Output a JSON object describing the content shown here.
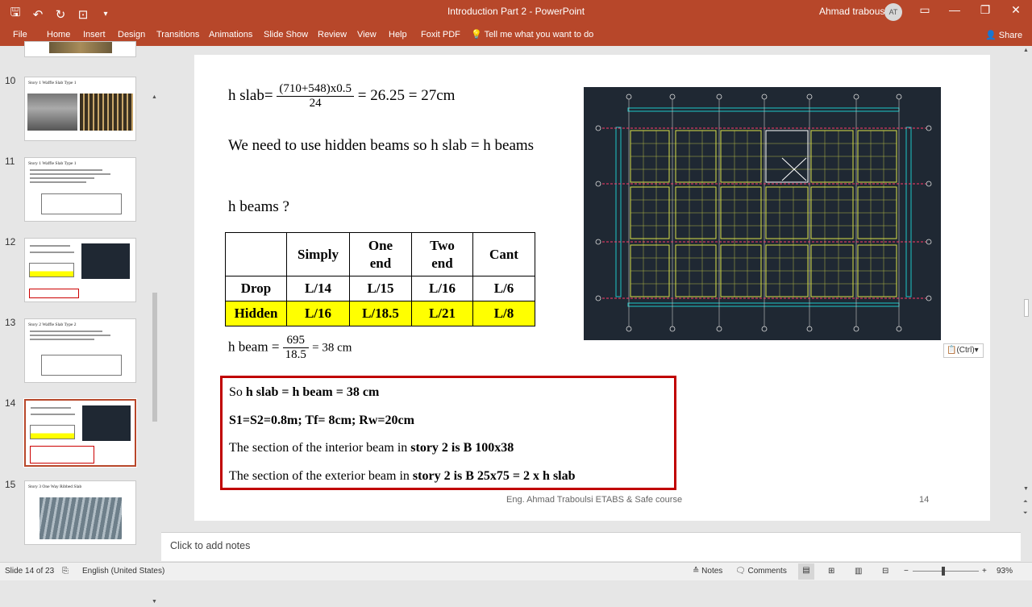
{
  "window": {
    "title": "Introduction Part 2  -  PowerPoint",
    "user_name": "Ahmad trabousli",
    "user_initials": "AT"
  },
  "ribbon": {
    "tabs": [
      "File",
      "Home",
      "Insert",
      "Design",
      "Transitions",
      "Animations",
      "Slide Show",
      "Review",
      "View",
      "Help",
      "Foxit PDF"
    ],
    "tell_me": "Tell me what you want to do",
    "share": "Share"
  },
  "thumbnails": [
    {
      "num": "10",
      "title": "Story 1 Waffle Slab Type 1"
    },
    {
      "num": "11",
      "title": "Story 1 Waffle Slab Type 1"
    },
    {
      "num": "12",
      "title": ""
    },
    {
      "num": "13",
      "title": "Story 2 Waffle Slab Type 2"
    },
    {
      "num": "14",
      "title": ""
    },
    {
      "num": "15",
      "title": "Story 3 One Way Ribbed Slab"
    }
  ],
  "slide": {
    "hslab_label": "h slab=",
    "hslab_num": "(710+548)x0.5",
    "hslab_den": "24",
    "hslab_result": "= 26.25 = 27cm",
    "hidden_beams_text": "We need to use hidden beams so h slab = h beams",
    "h_beams_q": "h beams ?",
    "table": {
      "headers": [
        "",
        "Simply",
        "One end",
        "Two end",
        "Cant"
      ],
      "rows": [
        [
          "Drop",
          "L/14",
          "L/15",
          "L/16",
          "L/6"
        ],
        [
          "Hidden",
          "L/16",
          "L/18.5",
          "L/21",
          "L/8"
        ]
      ],
      "highlight_color": "#ffff00"
    },
    "hbeam_label": "h beam =",
    "hbeam_num": "695",
    "hbeam_den": "18.5",
    "hbeam_result": "= 38 cm",
    "box_lines": [
      {
        "plain": "So ",
        "bold": "h slab = h beam = 38 cm",
        "tail": ""
      },
      {
        "plain": "",
        "bold": "S1=S2=0.8m; Tf= 8cm; Rw=20cm",
        "tail": ""
      },
      {
        "plain": "The section of the interior beam in ",
        "bold": "story 2 is B 100x38",
        "tail": ""
      },
      {
        "plain": "The section of the exterior beam in ",
        "bold": "story 2 is B 25x75 = 2 x h slab",
        "tail": ""
      }
    ],
    "footer": "Eng. Ahmad Traboulsi ETABS & Safe course",
    "page_number": "14",
    "paste_options": "(Ctrl)"
  },
  "notes_placeholder": "Click to add notes",
  "status": {
    "slide_of": "Slide 14 of 23",
    "language": "English (United States)",
    "notes": "Notes",
    "comments": "Comments",
    "zoom": "93%"
  },
  "colors": {
    "accent": "#b7472a",
    "box_border": "#c00000",
    "plan_bg": "#1f2833"
  }
}
